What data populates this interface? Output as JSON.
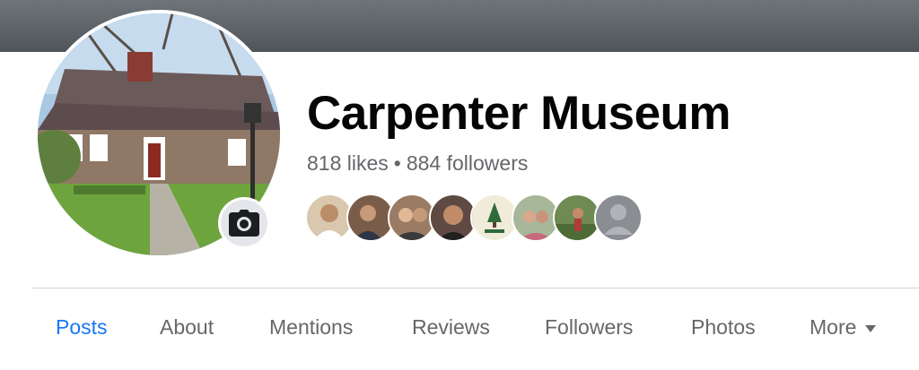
{
  "page": {
    "title": "Carpenter Museum",
    "likes": "818 likes",
    "separator": "•",
    "followers": "884 followers"
  },
  "profile_photo": {
    "subject": "house-photo",
    "camera_icon": "camera-icon"
  },
  "friends_who_like": [
    {
      "icon": "avatar-photo",
      "color": "#c9a27a"
    },
    {
      "icon": "avatar-photo",
      "color": "#5a4a3f"
    },
    {
      "icon": "avatar-photo",
      "color": "#8a6d58"
    },
    {
      "icon": "avatar-photo",
      "color": "#6b4f44"
    },
    {
      "icon": "logo-avatar",
      "color": "#f1ecd9"
    },
    {
      "icon": "avatar-photo",
      "color": "#b68c7a"
    },
    {
      "icon": "avatar-photo",
      "color": "#6f8a52"
    },
    {
      "icon": "default-avatar",
      "color": "#8a8d91"
    }
  ],
  "tabs": [
    {
      "label": "Posts",
      "active": true
    },
    {
      "label": "About",
      "active": false
    },
    {
      "label": "Mentions",
      "active": false
    },
    {
      "label": "Reviews",
      "active": false
    },
    {
      "label": "Followers",
      "active": false
    },
    {
      "label": "Photos",
      "active": false
    },
    {
      "label": "More",
      "active": false,
      "icon": "caret-down-icon"
    }
  ],
  "colors": {
    "accent": "#1877f2",
    "secondary_text": "#65676b",
    "primary_text": "#050505"
  }
}
